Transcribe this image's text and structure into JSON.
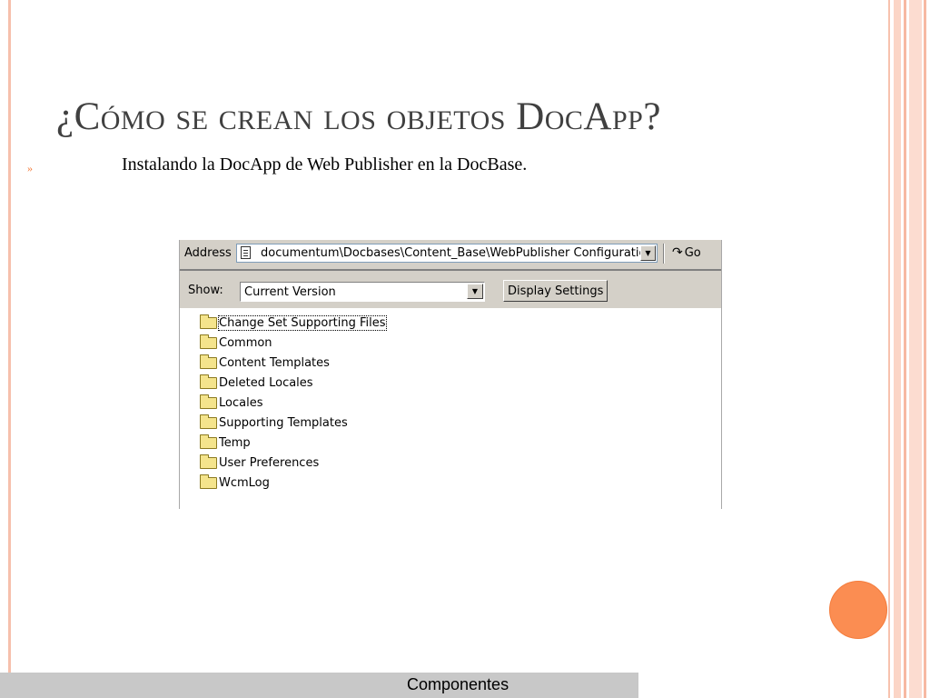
{
  "slide": {
    "title": "¿Cómo se crean los objetos DocApp?",
    "bullet_marker": "»",
    "bullet_text": "Instalando la DocApp de Web Publisher en la DocBase.",
    "footer": "Componentes"
  },
  "explorer": {
    "address_label": "Address",
    "address_value": "documentum\\Docbases\\Content_Base\\WebPublisher Configuration",
    "go_label": "Go",
    "show_label": "Show:",
    "show_value": "Current Version",
    "display_settings_label": "Display Settings",
    "folders": [
      "Change Set Supporting Files",
      "Common",
      "Content Templates",
      "Deleted Locales",
      "Locales",
      "Supporting Templates",
      "Temp",
      "User Preferences",
      "WcmLog"
    ],
    "selected_folder": "Change Set Supporting Files"
  },
  "colors": {
    "accent": "#fb8d52",
    "stripe": "#f7b9a2",
    "title_text": "#404040",
    "folder_fill": "#f4e48c"
  },
  "icons": [
    "document-icon",
    "dropdown-arrow-icon",
    "go-arrow-icon",
    "folder-icon"
  ]
}
